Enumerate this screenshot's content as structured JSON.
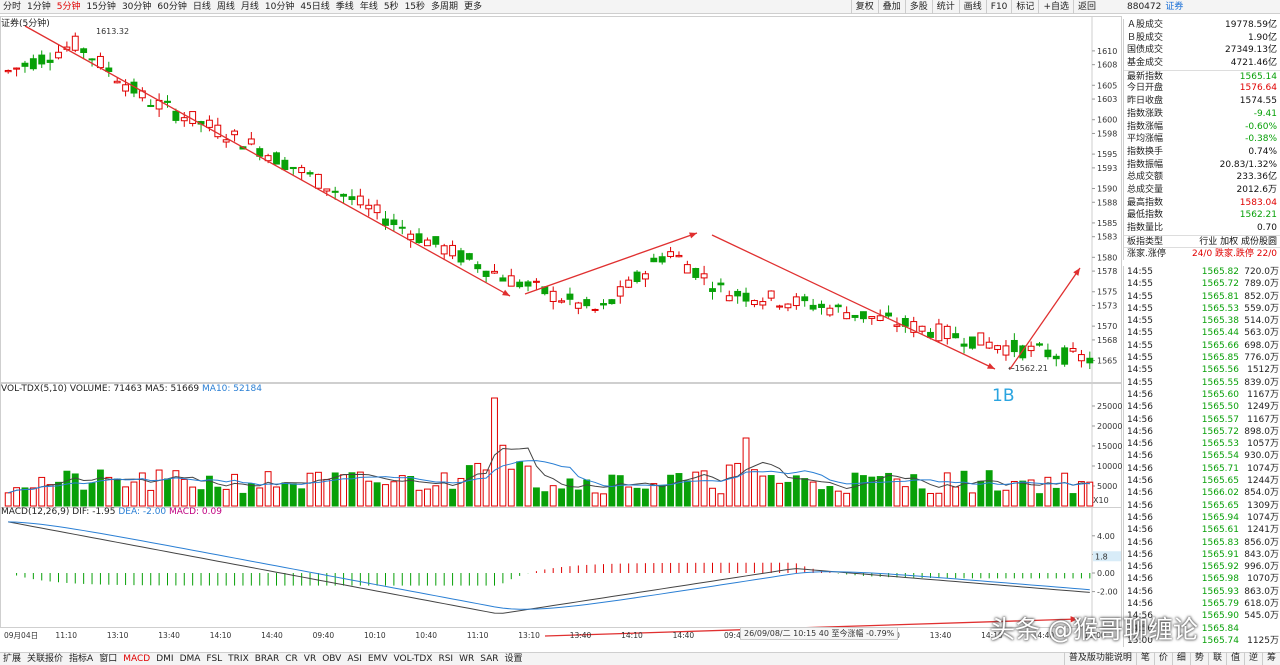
{
  "periods": [
    "分时",
    "1分钟",
    "5分钟",
    "15分钟",
    "30分钟",
    "60分钟",
    "日线",
    "周线",
    "月线",
    "10分钟",
    "45日线",
    "季线",
    "年线",
    "5秒",
    "15秒",
    "多周期",
    "更多"
  ],
  "active_period": "5分钟",
  "toolbar": [
    "复权",
    "叠加",
    "多股",
    "统计",
    "画线",
    "F10",
    "标记",
    "+自选",
    "返回"
  ],
  "stock": {
    "code": "880472",
    "name": "证券"
  },
  "kline_title": "证券(5分钟)",
  "high_label": "1613.32",
  "low_label": "1562.21",
  "price_axis": [
    "1610",
    "1608",
    "1605",
    "1603",
    "1600",
    "1598",
    "1595",
    "1593",
    "1590",
    "1588",
    "1585",
    "1583",
    "1580",
    "1578",
    "1575",
    "1573",
    "1570",
    "1568",
    "1565"
  ],
  "vol_title": {
    "a": "VOL-TDX(5,10)",
    "b": "VOLUME: 71463",
    "c": "MA5: 51669",
    "d": "MA10: 52184"
  },
  "vol_axis": [
    "25000",
    "20000",
    "15000",
    "10000",
    "5000"
  ],
  "vol_unit": "X10",
  "macd_title": {
    "a": "MACD(12,26,9)",
    "b": "DIF: -1.95",
    "c": "DEA: -2.00",
    "d": "MACD: 0.09"
  },
  "macd_axis": [
    "4.00",
    "2.00",
    "0.00",
    "-2.00"
  ],
  "macd_tag": "1.8",
  "time_axis": [
    "09月04日",
    "11:10",
    "13:10",
    "13:40",
    "14:10",
    "14:40",
    "09:40",
    "10:10",
    "10:40",
    "11:10",
    "13:10",
    "13:40",
    "14:10",
    "14:40",
    "09:40",
    "10:10",
    "10:40",
    "13:10",
    "13:40",
    "14:10",
    "14:40",
    "15:00"
  ],
  "status_bar": "26/09/08/二 10:15 40 至今涨幅 -0.79%",
  "label_1b": "1B",
  "watermark": "头条 @猴哥聊缠论",
  "bottom_tabs": [
    "指标A",
    "窗口",
    "MACD",
    "DMI",
    "DMA",
    "FSL",
    "TRIX",
    "BRAR",
    "CR",
    "VR",
    "OBV",
    "ASI",
    "EMV",
    "VOL-TDX",
    "RSI",
    "WR",
    "SAR",
    "设置"
  ],
  "bottom_left": [
    "扩展",
    "关联报价"
  ],
  "bottom_right": [
    "普及版功能说明",
    "笔",
    "价",
    "细",
    "势",
    "联",
    "值",
    "逆",
    "筹"
  ],
  "bottom_active": "MACD",
  "info": [
    {
      "l": "Ａ股成交",
      "v": "19778.59亿",
      "c": ""
    },
    {
      "l": "Ｂ股成交",
      "v": "1.90亿",
      "c": ""
    },
    {
      "l": "国债成交",
      "v": "27349.13亿",
      "c": ""
    },
    {
      "l": "基金成交",
      "v": "4721.46亿",
      "c": ""
    },
    {
      "l": "最新指数",
      "v": "1565.14",
      "c": "green",
      "sep": true
    },
    {
      "l": "今日开盘",
      "v": "1576.64",
      "c": "red"
    },
    {
      "l": "昨日收盘",
      "v": "1574.55",
      "c": ""
    },
    {
      "l": "指数涨跌",
      "v": "-9.41",
      "c": "green"
    },
    {
      "l": "指数涨幅",
      "v": "-0.60%",
      "c": "green"
    },
    {
      "l": "平均涨幅",
      "v": "-0.38%",
      "c": "green"
    },
    {
      "l": "指数换手",
      "v": "0.74%",
      "c": ""
    },
    {
      "l": "指数振幅",
      "v": "20.83/1.32%",
      "c": ""
    },
    {
      "l": "总成交额",
      "v": "233.36亿",
      "c": ""
    },
    {
      "l": "总成交量",
      "v": "2012.6万",
      "c": ""
    },
    {
      "l": "最高指数",
      "v": "1583.04",
      "c": "red"
    },
    {
      "l": "最低指数",
      "v": "1562.21",
      "c": "green"
    },
    {
      "l": "指数量比",
      "v": "0.70",
      "c": ""
    },
    {
      "l": "板指类型",
      "v": "行业 加权 成份股圆",
      "c": "",
      "sep": true
    },
    {
      "l": "涨家.涨停",
      "v": "24/0  跌家.跌停  22/0",
      "c": "red",
      "sep": true
    }
  ],
  "trades": [
    [
      "14:55",
      "1565.82",
      "720.0万"
    ],
    [
      "14:55",
      "1565.72",
      "789.0万"
    ],
    [
      "14:55",
      "1565.81",
      "852.0万"
    ],
    [
      "14:55",
      "1565.53",
      "559.0万"
    ],
    [
      "14:55",
      "1565.38",
      "514.0万"
    ],
    [
      "14:55",
      "1565.44",
      "563.0万"
    ],
    [
      "14:55",
      "1565.66",
      "698.0万"
    ],
    [
      "14:55",
      "1565.85",
      "776.0万"
    ],
    [
      "14:55",
      "1565.56",
      "1512万"
    ],
    [
      "14:55",
      "1565.55",
      "839.0万"
    ],
    [
      "14:56",
      "1565.60",
      "1167万"
    ],
    [
      "14:56",
      "1565.50",
      "1249万"
    ],
    [
      "14:56",
      "1565.57",
      "1167万"
    ],
    [
      "14:56",
      "1565.72",
      "898.0万"
    ],
    [
      "14:56",
      "1565.53",
      "1057万"
    ],
    [
      "14:56",
      "1565.54",
      "930.0万"
    ],
    [
      "14:56",
      "1565.71",
      "1074万"
    ],
    [
      "14:56",
      "1565.65",
      "1244万"
    ],
    [
      "14:56",
      "1566.02",
      "854.0万"
    ],
    [
      "14:56",
      "1565.65",
      "1309万"
    ],
    [
      "14:56",
      "1565.94",
      "1074万"
    ],
    [
      "14:56",
      "1565.61",
      "1241万"
    ],
    [
      "14:56",
      "1565.83",
      "856.0万"
    ],
    [
      "14:56",
      "1565.91",
      "843.0万"
    ],
    [
      "14:56",
      "1565.92",
      "996.0万"
    ],
    [
      "14:56",
      "1565.98",
      "1070万"
    ],
    [
      "14:56",
      "1565.93",
      "863.0万"
    ],
    [
      "14:56",
      "1565.79",
      "618.0万"
    ],
    [
      "14:56",
      "1565.90",
      "545.0万"
    ],
    [
      "14:56",
      "1565.84",
      "",
      "trunc"
    ],
    [
      "15:00",
      "1565.74",
      "1125万"
    ]
  ],
  "colors": {
    "up": "#e00000",
    "down": "#08a008",
    "arrow": "#e03030",
    "dif": "#444444",
    "dea": "#2a7fd4",
    "ma5": "#444444",
    "ma10": "#2a7fd4"
  }
}
